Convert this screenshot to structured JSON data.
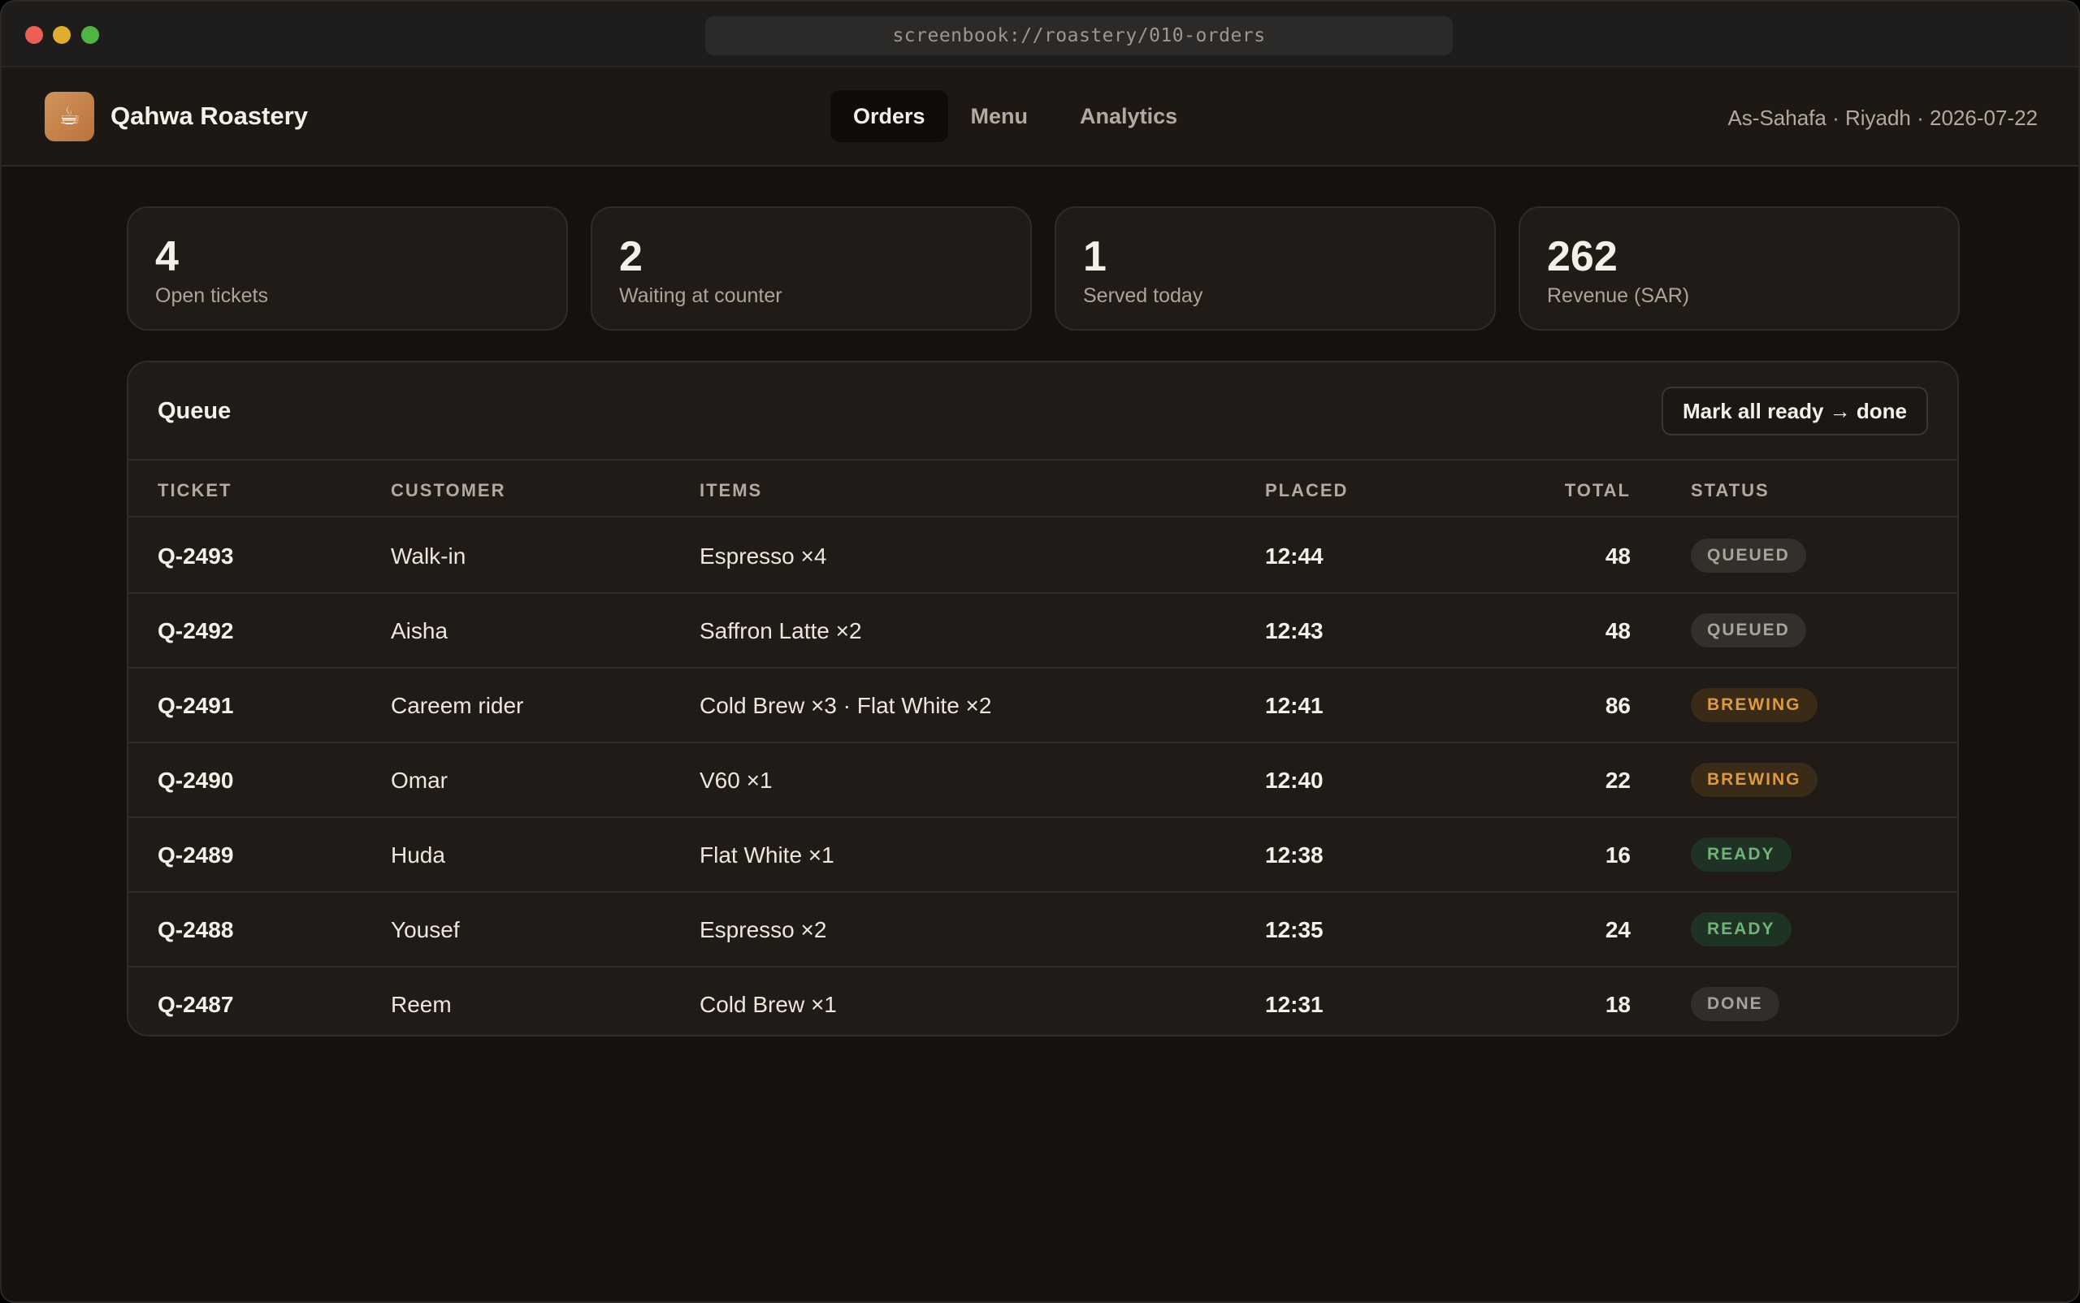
{
  "browser": {
    "url": "screenbook://roastery/010-orders"
  },
  "app": {
    "logo_icon": "coffee-cup-icon",
    "name": "Qahwa Roastery",
    "nav": [
      {
        "label": "Orders",
        "active": true
      },
      {
        "label": "Menu",
        "active": false
      },
      {
        "label": "Analytics",
        "active": false
      }
    ],
    "location": "As-Sahafa · Riyadh · 2026-07-22"
  },
  "stats": [
    {
      "value": "4",
      "label": "Open tickets"
    },
    {
      "value": "2",
      "label": "Waiting at counter"
    },
    {
      "value": "1",
      "label": "Served today"
    },
    {
      "value": "262",
      "label": "Revenue (SAR)"
    }
  ],
  "queue": {
    "title": "Queue",
    "action_label": "Mark all ready → done",
    "columns": {
      "ticket": "TICKET",
      "customer": "CUSTOMER",
      "items": "ITEMS",
      "placed": "PLACED",
      "total": "TOTAL",
      "status": "STATUS"
    },
    "rows": [
      {
        "ticket": "Q-2493",
        "customer": "Walk-in",
        "items": "Espresso ×4",
        "placed": "12:44",
        "total": "48",
        "status": "QUEUED"
      },
      {
        "ticket": "Q-2492",
        "customer": "Aisha",
        "items": "Saffron Latte ×2",
        "placed": "12:43",
        "total": "48",
        "status": "QUEUED"
      },
      {
        "ticket": "Q-2491",
        "customer": "Careem rider",
        "items": "Cold Brew ×3 · Flat White ×2",
        "placed": "12:41",
        "total": "86",
        "status": "BREWING"
      },
      {
        "ticket": "Q-2490",
        "customer": "Omar",
        "items": "V60 ×1",
        "placed": "12:40",
        "total": "22",
        "status": "BREWING"
      },
      {
        "ticket": "Q-2489",
        "customer": "Huda",
        "items": "Flat White ×1",
        "placed": "12:38",
        "total": "16",
        "status": "READY"
      },
      {
        "ticket": "Q-2488",
        "customer": "Yousef",
        "items": "Espresso ×2",
        "placed": "12:35",
        "total": "24",
        "status": "READY"
      },
      {
        "ticket": "Q-2487",
        "customer": "Reem",
        "items": "Cold Brew ×1",
        "placed": "12:31",
        "total": "18",
        "status": "DONE"
      }
    ]
  },
  "colors": {
    "background": "#14110e",
    "surface": "#211b17",
    "brand": "#d3935a",
    "status_queued": "#a8a29a",
    "status_brewing": "#dd9a3e",
    "status_ready": "#6fb27a",
    "status_done": "#a8a29a"
  }
}
